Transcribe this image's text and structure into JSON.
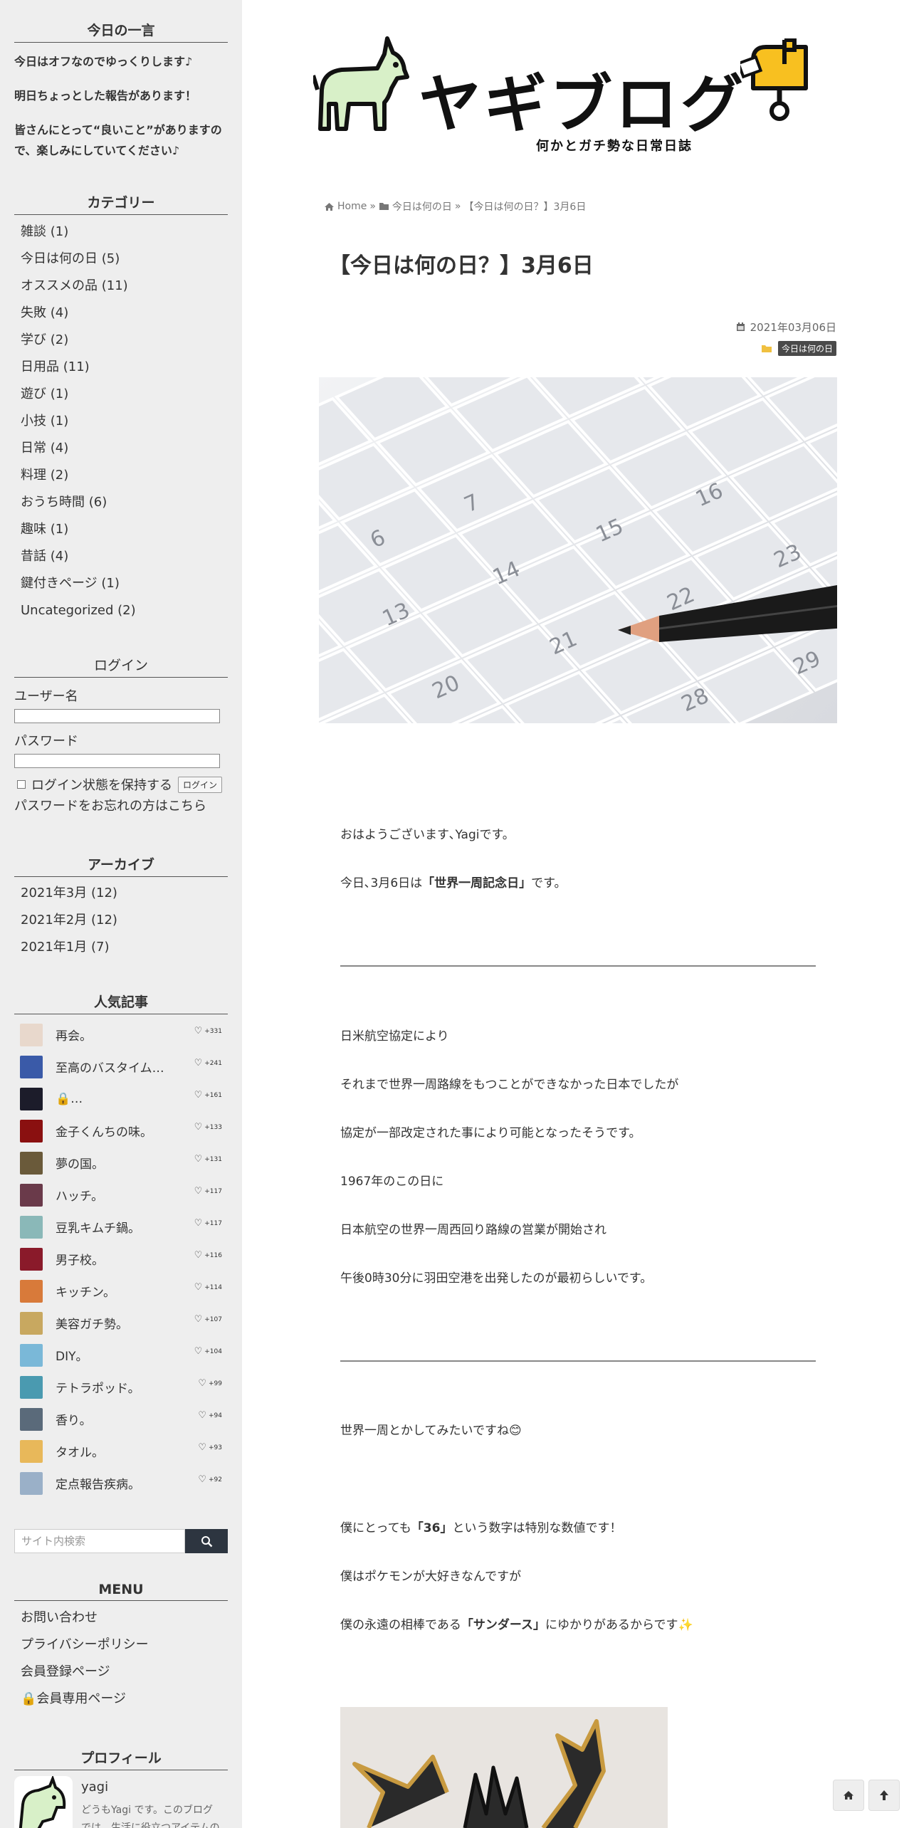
{
  "sidebar": {
    "oneliner": {
      "title": "今日の一言",
      "lines": [
        "今日はオフなのでゆっくりします♪",
        "明日ちょっとした報告があります！",
        "皆さんにとって“良いこと”がありますの",
        "で、楽しみにしていてください♪"
      ]
    },
    "categories": {
      "title": "カテゴリー",
      "items": [
        "雑談 (1)",
        "今日は何の日 (5)",
        "オススメの品 (11)",
        "失敗 (4)",
        "学び (2)",
        "日用品 (11)",
        "遊び (1)",
        "小技 (1)",
        "日常 (4)",
        "料理 (2)",
        "おうち時間 (6)",
        "趣味 (1)",
        "昔話 (4)",
        "鍵付きページ (1)",
        "Uncategorized (2)"
      ]
    },
    "login": {
      "title": "ログイン",
      "username_label": "ユーザー名",
      "password_label": "パスワード",
      "remember_label": "ログイン状態を保持する",
      "login_button": "ログイン",
      "forgot_link": "パスワードをお忘れの方はこちら"
    },
    "archives": {
      "title": "アーカイブ",
      "items": [
        "2021年3月 (12)",
        "2021年2月 (12)",
        "2021年1月 (7)"
      ]
    },
    "popular": {
      "title": "人気記事",
      "items": [
        {
          "title": "再会。",
          "likes": "+331",
          "color": "#e8d8cc"
        },
        {
          "title": "至高のバスタイム…",
          "likes": "+241",
          "color": "#3a5aa8"
        },
        {
          "title": "🔒…",
          "likes": "+161",
          "color": "#1c1c2a"
        },
        {
          "title": "金子くんちの味。",
          "likes": "+133",
          "color": "#8a1010"
        },
        {
          "title": "夢の国。",
          "likes": "+131",
          "color": "#6a5a3a"
        },
        {
          "title": "ハッチ。",
          "likes": "+117",
          "color": "#6a3a4a"
        },
        {
          "title": "豆乳キムチ鍋。",
          "likes": "+117",
          "color": "#8ab8b8"
        },
        {
          "title": "男子校。",
          "likes": "+116",
          "color": "#8a1a2a"
        },
        {
          "title": "キッチン。",
          "likes": "+114",
          "color": "#d87a3a"
        },
        {
          "title": "美容ガチ勢。",
          "likes": "+107",
          "color": "#c8a860"
        },
        {
          "title": "DIY。",
          "likes": "+104",
          "color": "#7ab8d8"
        },
        {
          "title": "テトラポッド。",
          "likes": "+99",
          "color": "#4a9ab0"
        },
        {
          "title": "香り。",
          "likes": "+94",
          "color": "#5a6a7a"
        },
        {
          "title": "タオル。",
          "likes": "+93",
          "color": "#e8b85a"
        },
        {
          "title": "定点報告疾病。",
          "likes": "+92",
          "color": "#9ab0c8"
        }
      ]
    },
    "search": {
      "placeholder": "サイト内検索"
    },
    "menu": {
      "title": "MENU",
      "items": [
        "お問い合わせ",
        "プライバシーポリシー",
        "会員登録ページ",
        "🔒会員専用ページ"
      ]
    },
    "profile": {
      "title": "プロフィール",
      "name": "yagi",
      "bio_line1": "どうもYagi です。このブログ",
      "bio_line2": "では、生活に役立つアイテムの"
    }
  },
  "header": {
    "logo_text": "ヤギブログ",
    "tagline": "何かとガチ勢な日常日誌"
  },
  "breadcrumb": {
    "home": "Home",
    "sep": "»",
    "category": "今日は何の日",
    "current": "【今日は何の日？】3月6日"
  },
  "article": {
    "title": "【今日は何の日？】3月6日",
    "date": "2021年03月06日",
    "tag": "今日は何の日",
    "calendar_numbers": [
      "6",
      "7",
      "13",
      "14",
      "15",
      "16",
      "20",
      "21",
      "22",
      "23",
      "28",
      "29"
    ],
    "paragraphs": {
      "p1": "おはようございます､Yagiです。",
      "p2_pre": "今日､3月6日は",
      "p2_bold": "「世界一周記念日」",
      "p2_post": "です。",
      "p3": "日米航空協定により",
      "p4": "それまで世界一周路線をもつことができなかった日本でしたが",
      "p5": "協定が一部改定された事により可能となったそうです。",
      "p6": "1967年のこの日に",
      "p7": "日本航空の世界一周西回り路線の営業が開始され",
      "p8": "午後0時30分に羽田空港を出発したのが最初らしいです。",
      "p9": "世界一周とかしてみたいですね😊",
      "p10_pre": "僕にとっても",
      "p10_bold": "「36」",
      "p10_post": "という数字は特別な数値です！",
      "p11": "僕はポケモンが大好きなんですが",
      "p12_pre": "僕の永遠の相棒である",
      "p12_bold": "「サンダース」",
      "p12_post": "にゆかりがあるからです✨"
    }
  },
  "colors": {
    "sidebar_bg": "#eeeeee",
    "search_button": "#2d3540",
    "tag_bg": "#4a4a4a",
    "folder_icon": "#f0c040",
    "goat_green": "#d8f0c8",
    "mailbox_yellow": "#f8c020"
  },
  "icons": [
    "home-icon",
    "folder-icon",
    "calendar-icon",
    "heart-icon",
    "search-icon",
    "lock-icon",
    "arrow-up-icon"
  ]
}
